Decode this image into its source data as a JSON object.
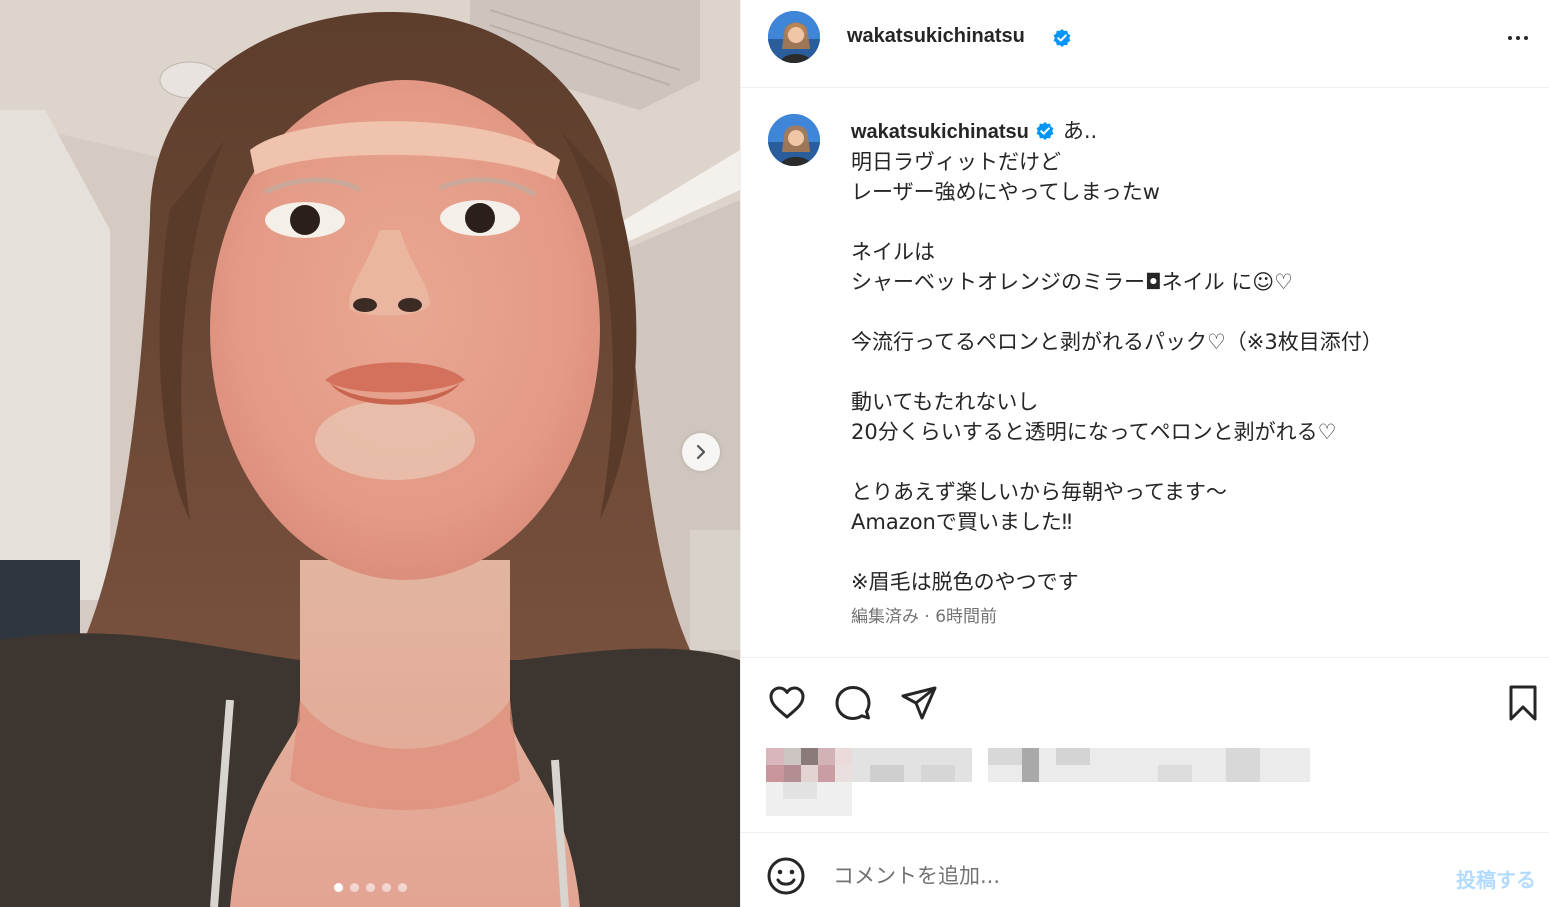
{
  "post": {
    "username": "wakatsukichinatsu",
    "caption_lines": "あ..\n明日ラヴィットだけど\nレーザー強めにやってしまったw\n\nネイルは\nシャーベットオレンジのミラー◘ネイル に☺♡\n\n今流行ってるペロンと剥がれるパック♡（※3枚目添付）\n\n動いてもたれないし\n20分くらいすると透明になってペロンと剥がれる♡\n\nとりあえず楽しいから毎朝やってます〜\nAmazonで買いました‼\n\n※眉毛は脱色のやつです",
    "meta": "編集済み · 6時間前"
  },
  "comment": {
    "placeholder": "コメントを追加...",
    "post_label": "投稿する"
  },
  "carousel": {
    "total": 5,
    "active_index": 0
  },
  "colors": {
    "verified": "#0095f6",
    "post_button_disabled": "#b3dbff",
    "meta_text": "#737373"
  },
  "icons": {
    "more": "more-options-icon",
    "next": "chevron-right-icon",
    "like": "heart-icon",
    "comment": "comment-icon",
    "share": "paper-plane-icon",
    "save": "bookmark-icon",
    "emoji": "smiley-icon",
    "verified": "verified-badge-icon"
  }
}
